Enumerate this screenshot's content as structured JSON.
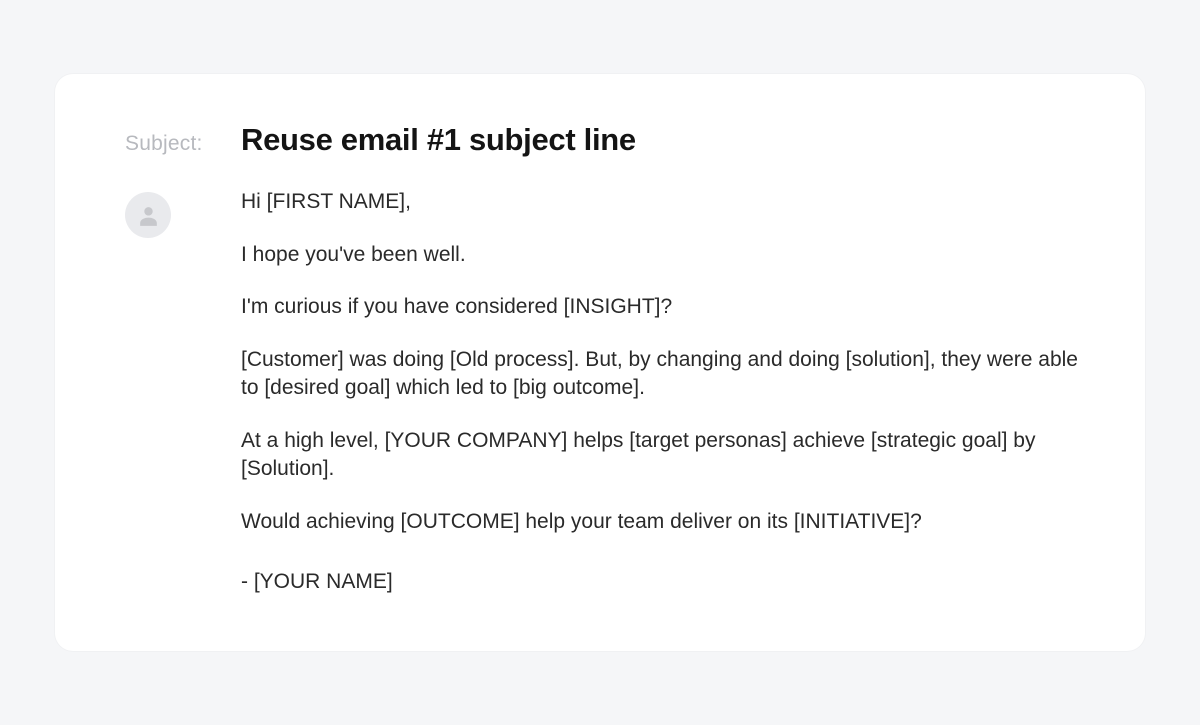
{
  "subject": {
    "label": "Subject:",
    "value": "Reuse email #1 subject line"
  },
  "body": {
    "greeting": "Hi [FIRST NAME],",
    "p1": "I hope you've been well.",
    "p2": "I'm curious if you have considered [INSIGHT]?",
    "p3": "[Customer] was doing [Old process]. But, by changing and doing [solution], they were able to [desired goal] which led to [big outcome].",
    "p4": "At a high level, [YOUR COMPANY] helps [target personas] achieve [strategic goal] by [Solution].",
    "p5": "Would achieving [OUTCOME] help your team deliver on its [INITIATIVE]?",
    "signature": "- [YOUR NAME]"
  }
}
